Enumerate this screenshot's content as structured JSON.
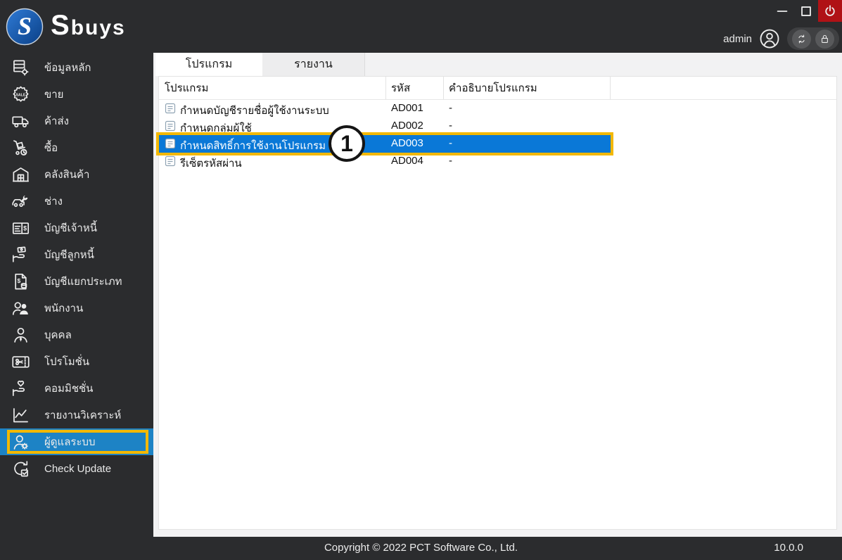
{
  "topbar": {
    "logo_text": "Sbuys",
    "user_label": "admin",
    "controls": [
      "minimize",
      "maximize",
      "power"
    ],
    "quick_buttons": [
      "refresh",
      "lock"
    ]
  },
  "sidebar": {
    "items": [
      {
        "label": "ข้อมูลหลัก",
        "icon": "master-data-icon"
      },
      {
        "label": "ขาย",
        "icon": "sale-icon"
      },
      {
        "label": "ค้าส่ง",
        "icon": "delivery-truck-icon"
      },
      {
        "label": "ซื้อ",
        "icon": "purchase-cart-icon"
      },
      {
        "label": "คลังสินค้า",
        "icon": "warehouse-icon"
      },
      {
        "label": "ช่าง",
        "icon": "mechanic-icon"
      },
      {
        "label": "บัญชีเจ้าหนี้",
        "icon": "accounts-payable-icon"
      },
      {
        "label": "บัญชีลูกหนี้",
        "icon": "accounts-receivable-icon"
      },
      {
        "label": "บัญชีแยกประเภท",
        "icon": "general-ledger-icon"
      },
      {
        "label": "พนักงาน",
        "icon": "employees-icon"
      },
      {
        "label": "บุคคล",
        "icon": "person-icon"
      },
      {
        "label": "โปรโมชั่น",
        "icon": "promotion-icon"
      },
      {
        "label": "คอมมิชชั่น",
        "icon": "commission-icon"
      },
      {
        "label": "รายงานวิเคราะห์",
        "icon": "analytics-icon"
      },
      {
        "label": "ผู้ดูแลระบบ",
        "icon": "admin-user-icon",
        "selected": true
      },
      {
        "label": "Check Update",
        "icon": "check-update-icon"
      }
    ]
  },
  "main": {
    "tabs": [
      {
        "label": "โปรแกรม",
        "active": true
      },
      {
        "label": "รายงาน",
        "active": false
      }
    ],
    "table": {
      "columns": [
        "โปรแกรม",
        "รหัส",
        "คำอธิบายโปรแกรม"
      ],
      "rows": [
        {
          "name": "กำหนดบัญชีรายชื่อผู้ใช้งานระบบ",
          "code": "AD001",
          "desc": "-",
          "selected": false
        },
        {
          "name": "กำหนดกลุ่มผู้ใช้",
          "code": "AD002",
          "desc": "-",
          "selected": false
        },
        {
          "name": "กำหนดสิทธิ์การใช้งานโปรแกรม",
          "code": "AD003",
          "desc": "-",
          "selected": true
        },
        {
          "name": "รีเซ็ตรหัสผ่าน",
          "code": "AD004",
          "desc": "-",
          "selected": false
        }
      ]
    },
    "annotation": {
      "number": "1"
    }
  },
  "footer": {
    "copyright": "Copyright © 2022 PCT Software Co., Ltd.",
    "version": "10.0.0"
  },
  "colors": {
    "topbar_bg": "#2b2c2e",
    "power_red": "#b01216",
    "row_highlight_blue": "#0a78d7",
    "sidebar_highlight_blue": "#1d83c5",
    "annotation_yellow": "#f3b800",
    "logo_blue": "#1c63b7"
  }
}
